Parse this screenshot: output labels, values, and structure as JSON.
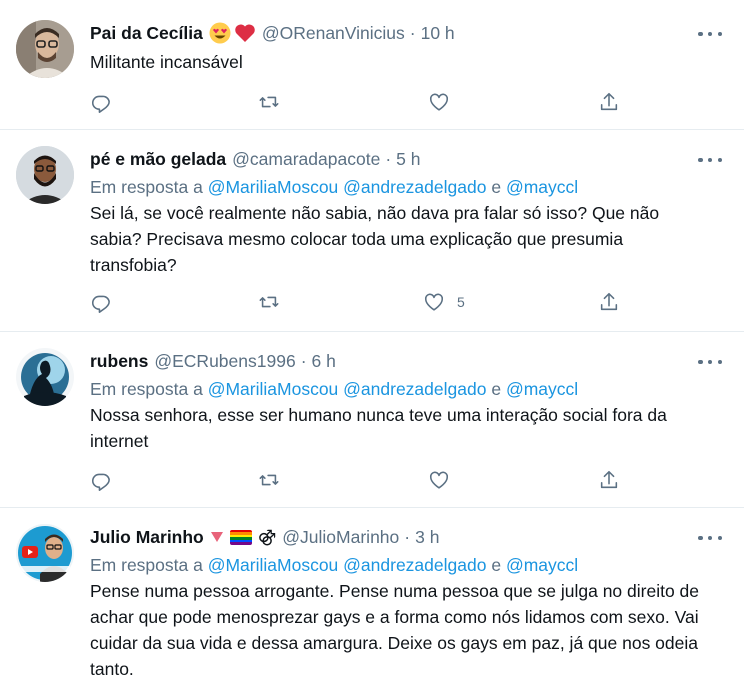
{
  "tweets": [
    {
      "display_name": "Pai da Cecília",
      "handle": "@ORenanVinicius",
      "time": "10 h",
      "reply_prefix": "",
      "mentions": [],
      "text": "Militante incansável",
      "likes": "",
      "avatar_icon": "person-with-glasses-avatar"
    },
    {
      "display_name": "pé e mão gelada",
      "handle": "@camaradapacote",
      "time": "5 h",
      "reply_prefix": "Em resposta a",
      "mentions": [
        "@MariliaMoscou",
        "@andrezadelgado",
        "e",
        "@mayccl"
      ],
      "text": "Sei lá, se você realmente não sabia, não dava pra falar só isso? Que não sabia? Precisava mesmo colocar toda uma explicação que presumia transfobia?",
      "likes": "5",
      "avatar_icon": "bearded-person-avatar"
    },
    {
      "display_name": "rubens",
      "handle": "@ECRubens1996",
      "time": "6 h",
      "reply_prefix": "Em resposta a",
      "mentions": [
        "@MariliaMoscou",
        "@andrezadelgado",
        "e",
        "@mayccl"
      ],
      "text": "Nossa senhora, esse ser humano nunca teve uma interação social fora da internet",
      "likes": "",
      "avatar_icon": "silhouette-avatar"
    },
    {
      "display_name": "Julio Marinho",
      "handle": "@JulioMarinho",
      "time": "3 h",
      "reply_prefix": "Em resposta a",
      "mentions": [
        "@MariliaMoscou",
        "@andrezadelgado",
        "e",
        "@mayccl"
      ],
      "text": "Pense numa pessoa arrogante. Pense numa pessoa que se julga no direito de achar que pode menosprezar gays e a forma como nós lidamos com sexo. Vai cuidar da sua vida e dessa amargura. Deixe os gays em paz, já que nos odeia tanto.",
      "likes": "",
      "avatar_icon": "youtube-channel-avatar"
    }
  ],
  "name_badges": {
    "tweet0": [
      "heart-eyes-emoji",
      "red-heart-emoji"
    ],
    "tweet3": [
      "pink-triangle-icon",
      "rainbow-flag-icon",
      "double-male-symbol"
    ],
    "gender_symbol": "⚣"
  },
  "colors": {
    "accent": "#1b95e0",
    "muted": "#5b7083",
    "text": "#0f1419",
    "divider": "#e6ecf0"
  }
}
